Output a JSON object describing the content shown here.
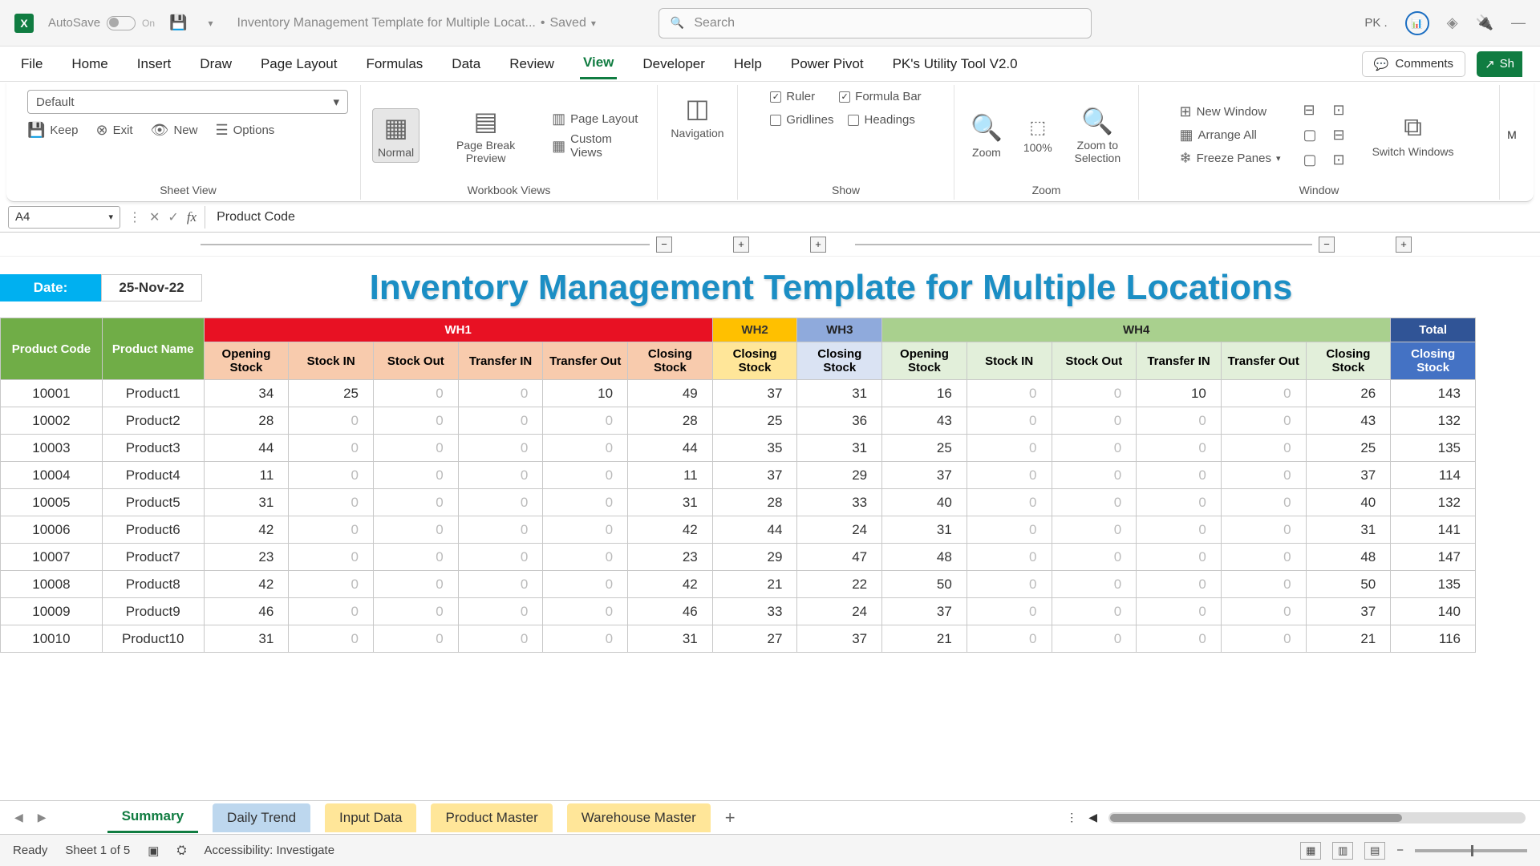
{
  "title_bar": {
    "autosave": "AutoSave",
    "autosave_state": "On",
    "doc_name": "Inventory Management Template for Multiple Locat...",
    "saved": "Saved",
    "search_placeholder": "Search",
    "user": "PK ."
  },
  "ribbon_tabs": [
    "File",
    "Home",
    "Insert",
    "Draw",
    "Page Layout",
    "Formulas",
    "Data",
    "Review",
    "View",
    "Developer",
    "Help",
    "Power Pivot",
    "PK's Utility Tool V2.0"
  ],
  "ribbon_active": "View",
  "ribbon_right": {
    "comments": "Comments",
    "share": "Sh"
  },
  "ribbon": {
    "sheet_view": {
      "select_value": "Default",
      "keep": "Keep",
      "exit": "Exit",
      "new": "New",
      "options": "Options",
      "label": "Sheet View"
    },
    "workbook_views": {
      "normal": "Normal",
      "page_break": "Page Break Preview",
      "page_layout": "Page Layout",
      "custom": "Custom Views",
      "label": "Workbook Views"
    },
    "navigation": "Navigation",
    "show": {
      "ruler": "Ruler",
      "formula_bar": "Formula Bar",
      "gridlines": "Gridlines",
      "headings": "Headings",
      "label": "Show"
    },
    "zoom": {
      "zoom": "Zoom",
      "z100": "100%",
      "to_sel": "Zoom to Selection",
      "label": "Zoom"
    },
    "window": {
      "new_window": "New Window",
      "arrange": "Arrange All",
      "freeze": "Freeze Panes",
      "switch": "Switch Windows",
      "label": "Window"
    },
    "macros": "M"
  },
  "name_box": "A4",
  "formula": "Product Code",
  "sheet": {
    "date_label": "Date:",
    "date_value": "25-Nov-22",
    "title": "Inventory Management Template for Multiple Locations",
    "wh_headers": [
      "WH1",
      "WH2",
      "WH3",
      "WH4",
      "Total"
    ],
    "col_labels": {
      "prod_code": "Product Code",
      "prod_name": "Product Name",
      "opening": "Opening Stock",
      "stock_in": "Stock IN",
      "stock_out": "Stock Out",
      "transfer_in": "Transfer IN",
      "transfer_out": "Transfer Out",
      "closing": "Closing Stock"
    },
    "rows": [
      {
        "code": "10001",
        "name": "Product1",
        "wh1": [
          34,
          25,
          0,
          0,
          10,
          49
        ],
        "wh2c": 37,
        "wh3c": 31,
        "wh4": [
          16,
          0,
          0,
          10,
          0,
          26
        ],
        "total": 143
      },
      {
        "code": "10002",
        "name": "Product2",
        "wh1": [
          28,
          0,
          0,
          0,
          0,
          28
        ],
        "wh2c": 25,
        "wh3c": 36,
        "wh4": [
          43,
          0,
          0,
          0,
          0,
          43
        ],
        "total": 132
      },
      {
        "code": "10003",
        "name": "Product3",
        "wh1": [
          44,
          0,
          0,
          0,
          0,
          44
        ],
        "wh2c": 35,
        "wh3c": 31,
        "wh4": [
          25,
          0,
          0,
          0,
          0,
          25
        ],
        "total": 135
      },
      {
        "code": "10004",
        "name": "Product4",
        "wh1": [
          11,
          0,
          0,
          0,
          0,
          11
        ],
        "wh2c": 37,
        "wh3c": 29,
        "wh4": [
          37,
          0,
          0,
          0,
          0,
          37
        ],
        "total": 114
      },
      {
        "code": "10005",
        "name": "Product5",
        "wh1": [
          31,
          0,
          0,
          0,
          0,
          31
        ],
        "wh2c": 28,
        "wh3c": 33,
        "wh4": [
          40,
          0,
          0,
          0,
          0,
          40
        ],
        "total": 132
      },
      {
        "code": "10006",
        "name": "Product6",
        "wh1": [
          42,
          0,
          0,
          0,
          0,
          42
        ],
        "wh2c": 44,
        "wh3c": 24,
        "wh4": [
          31,
          0,
          0,
          0,
          0,
          31
        ],
        "total": 141
      },
      {
        "code": "10007",
        "name": "Product7",
        "wh1": [
          23,
          0,
          0,
          0,
          0,
          23
        ],
        "wh2c": 29,
        "wh3c": 47,
        "wh4": [
          48,
          0,
          0,
          0,
          0,
          48
        ],
        "total": 147
      },
      {
        "code": "10008",
        "name": "Product8",
        "wh1": [
          42,
          0,
          0,
          0,
          0,
          42
        ],
        "wh2c": 21,
        "wh3c": 22,
        "wh4": [
          50,
          0,
          0,
          0,
          0,
          50
        ],
        "total": 135
      },
      {
        "code": "10009",
        "name": "Product9",
        "wh1": [
          46,
          0,
          0,
          0,
          0,
          46
        ],
        "wh2c": 33,
        "wh3c": 24,
        "wh4": [
          37,
          0,
          0,
          0,
          0,
          37
        ],
        "total": 140
      },
      {
        "code": "10010",
        "name": "Product10",
        "wh1": [
          31,
          0,
          0,
          0,
          0,
          31
        ],
        "wh2c": 27,
        "wh3c": 37,
        "wh4": [
          21,
          0,
          0,
          0,
          0,
          21
        ],
        "total": 116
      }
    ]
  },
  "sheet_tabs": [
    "Summary",
    "Daily Trend",
    "Input Data",
    "Product Master",
    "Warehouse Master"
  ],
  "status": {
    "ready": "Ready",
    "sheet_count": "Sheet 1 of 5",
    "accessibility": "Accessibility: Investigate"
  }
}
